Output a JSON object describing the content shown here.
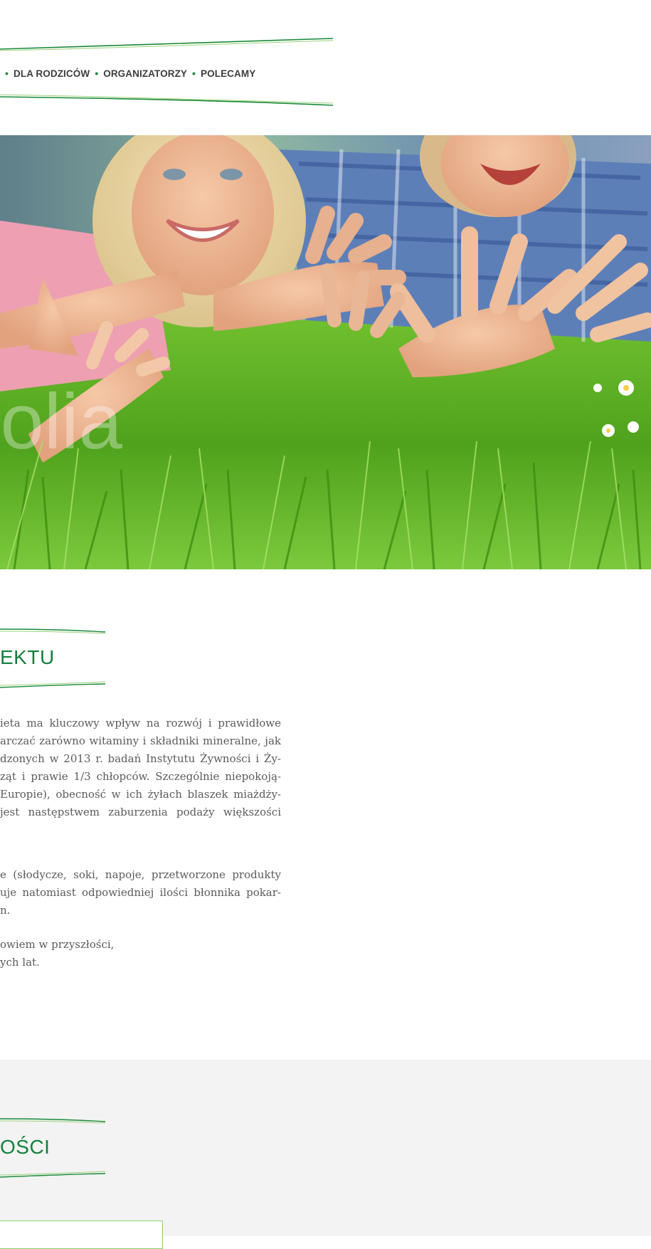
{
  "nav": {
    "items": [
      "DLA RODZICÓW",
      "ORGANIZATORZY",
      "POLECAMY"
    ]
  },
  "hero": {
    "watermark": "tolia"
  },
  "section1": {
    "heading": "EKTU",
    "paragraph1": [
      "ieta ma kluczowy wpływ na rozwój i prawidłowe",
      "arczać zarówno witaminy i składniki mineralne, jak",
      "dzonych w 2013 r. badań Instytutu Żywności i Ży-",
      "ząt i prawie 1/3 chłopców. Szczególnie niepokoją-",
      " Europie), obecność w ich żyłach blaszek miażdży-",
      " jest następstwem zaburzenia podaży większości"
    ],
    "paragraph2": [
      "e (słodycze, soki, napoje, przetworzone produkty",
      "uje natomiast odpowiedniej ilości błonnika pokar-",
      "n."
    ],
    "paragraph3": [
      "owiem w przyszłości,",
      "ych lat."
    ]
  },
  "section2": {
    "heading": "OŚCI"
  },
  "colors": {
    "accent_green": "#14803c",
    "rule_green": "#1a8a3a",
    "light_green": "#8fcf6a",
    "text_grey": "#5b5b5b",
    "band_grey": "#f3f3f3"
  }
}
